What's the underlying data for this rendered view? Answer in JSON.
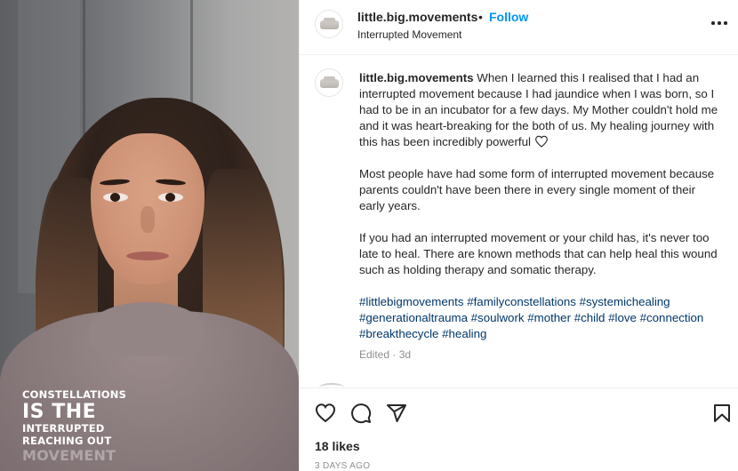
{
  "media": {
    "overlay_lines": [
      "CONSTELLATIONS",
      "IS THE",
      "INTERRUPTED",
      "REACHING OUT",
      "MOVEMENT"
    ]
  },
  "header": {
    "username": "little.big.movements",
    "separator": "•",
    "follow_label": "Follow",
    "subtitle": "Interrupted Movement",
    "avatar_icon": "brand-logo-avatar",
    "more_icon": "more-options-icon"
  },
  "caption": {
    "username": "little.big.movements",
    "paragraph_1": "When I learned this I realised that I had an interrupted movement because I had jaundice when I was born, so I had to be in an incubator for a few days. My Mother couldn't hold me and it was heart-breaking for the both of us. My healing journey with this has been incredibly powerful",
    "paragraph_1_icon": "heart-outline-icon",
    "paragraph_2": "Most people have had some form of interrupted movement because parents couldn't have been there in every single moment of their early years.",
    "paragraph_3": "If you had an interrupted movement or your child has, it's never too late to heal. There are known methods that can help heal this wound such as holding therapy and somatic therapy.",
    "hashtags": "#littlebigmovements #familyconstellations #systemichealing #generationaltrauma #soulwork #mother #child #love #connection #breakthecycle #healing",
    "edited": "Edited · 3d"
  },
  "actions": {
    "icons": [
      "like-icon",
      "comment-icon",
      "share-icon",
      "save-icon"
    ],
    "likes": "18 likes",
    "date": "3 DAYS AGO"
  }
}
